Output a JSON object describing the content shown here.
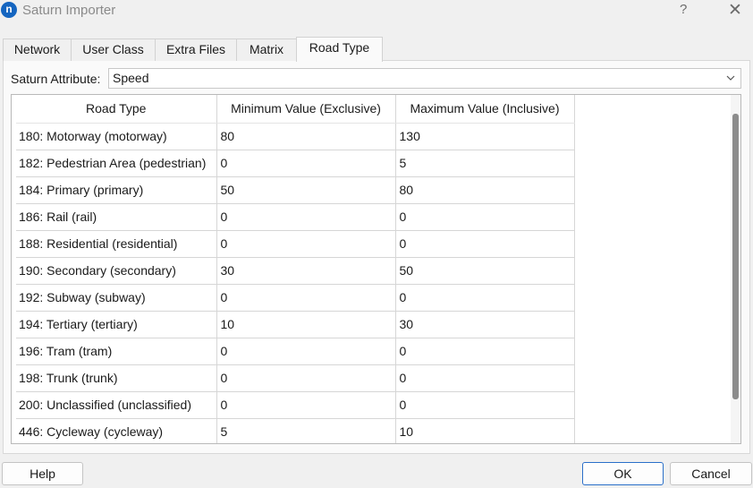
{
  "window": {
    "app_icon_glyph": "n",
    "title": "Saturn Importer",
    "help_glyph": "?",
    "close_glyph": "✕"
  },
  "tabs": [
    {
      "label": "Network",
      "active": false
    },
    {
      "label": "User Class",
      "active": false
    },
    {
      "label": "Extra Files",
      "active": false
    },
    {
      "label": "Matrix",
      "active": false
    },
    {
      "label": "Road Type",
      "active": true
    }
  ],
  "attribute": {
    "label": "Saturn Attribute:",
    "value": "Speed"
  },
  "table": {
    "columns": [
      "Road Type",
      "Minimum Value (Exclusive)",
      "Maximum Value (Inclusive)"
    ],
    "rows": [
      [
        "180: Motorway (motorway)",
        "80",
        "130"
      ],
      [
        "182: Pedestrian Area (pedestrian)",
        "0",
        "5"
      ],
      [
        "184: Primary (primary)",
        "50",
        "80"
      ],
      [
        "186: Rail (rail)",
        "0",
        "0"
      ],
      [
        "188: Residential (residential)",
        "0",
        "0"
      ],
      [
        "190: Secondary (secondary)",
        "30",
        "50"
      ],
      [
        "192: Subway (subway)",
        "0",
        "0"
      ],
      [
        "194: Tertiary (tertiary)",
        "10",
        "30"
      ],
      [
        "196: Tram (tram)",
        "0",
        "0"
      ],
      [
        "198: Trunk (trunk)",
        "0",
        "0"
      ],
      [
        "200: Unclassified (unclassified)",
        "0",
        "0"
      ],
      [
        "446: Cycleway (cycleway)",
        "5",
        "10"
      ]
    ]
  },
  "buttons": {
    "help": "Help",
    "ok": "OK",
    "cancel": "Cancel"
  },
  "colors": {
    "accent": "#1565c0",
    "ok_border": "#2a6fc9"
  }
}
